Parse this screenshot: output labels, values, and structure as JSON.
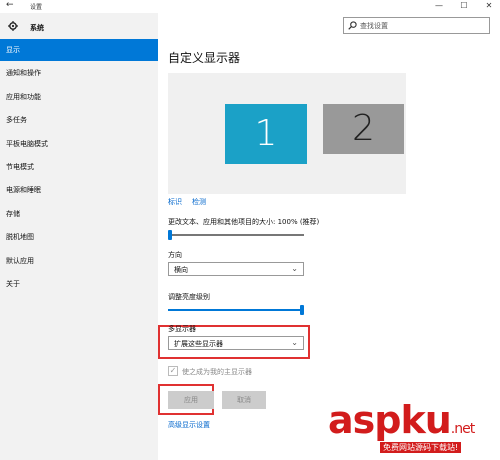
{
  "window": {
    "title": "设置",
    "back_glyph": "←",
    "minimize_glyph": "—",
    "maximize_glyph": "☐",
    "close_glyph": "✕"
  },
  "sidebar": {
    "header_label": "系统",
    "items": [
      {
        "label": "显示",
        "active": true
      },
      {
        "label": "通知和操作"
      },
      {
        "label": "应用和功能"
      },
      {
        "label": "多任务"
      },
      {
        "label": "平板电脑模式"
      },
      {
        "label": "节电模式"
      },
      {
        "label": "电源和睡眠"
      },
      {
        "label": "存储"
      },
      {
        "label": "脱机地图"
      },
      {
        "label": "默认应用"
      },
      {
        "label": "关于"
      }
    ]
  },
  "search": {
    "placeholder": "查找设置"
  },
  "main": {
    "title": "自定义显示器",
    "monitors": [
      "1",
      "2"
    ],
    "identify_link": "标识",
    "detect_link": "检测",
    "scale_label": "更改文本、应用和其他项目的大小: 100% (推荐)",
    "scale_value": 0,
    "orientation_label": "方向",
    "orientation_value": "横向",
    "brightness_label": "调整亮度级别",
    "brightness_value": 1.0,
    "multi_display_label": "多显示器",
    "multi_display_value": "扩展这些显示器",
    "main_display_checkbox": "使之成为我的主显示器",
    "apply_button": "应用",
    "cancel_button": "取消",
    "advanced_link": "高级显示设置"
  },
  "watermark": {
    "brand": "aspku",
    "domain": ".net",
    "tagline": "免费网站源码下载站!"
  },
  "colors": {
    "accent": "#0078d7",
    "monitor_selected": "#1ba1c7",
    "monitor_other": "#999999",
    "highlight_box": "#e03131"
  }
}
